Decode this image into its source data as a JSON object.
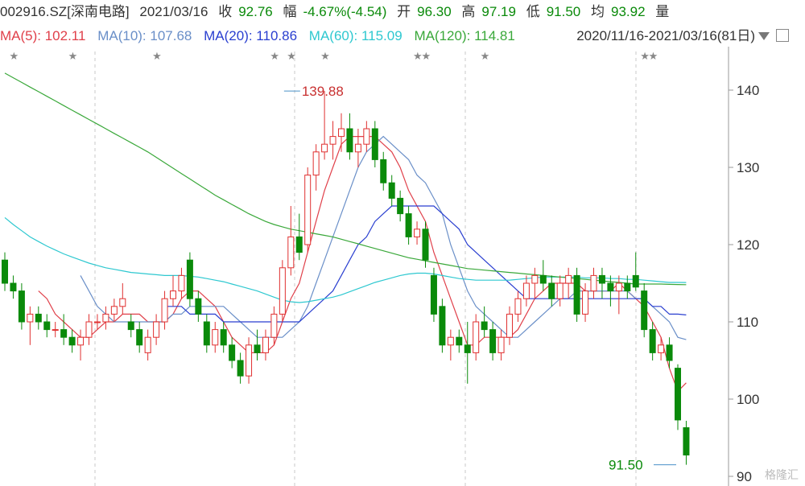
{
  "header": {
    "code": "002916.SZ[深南电路]",
    "date": "2021/03/16",
    "close_label": "收",
    "close": "92.76",
    "change_label": "幅",
    "change": "-4.67%(-4.54)",
    "open_label": "开",
    "open": "96.30",
    "high_label": "高",
    "high": "97.19",
    "low_label": "低",
    "low": "91.50",
    "avg_label": "均",
    "avg": "93.92",
    "vol_label": "量"
  },
  "ma_legend": [
    {
      "label": "MA(5): 102.11",
      "color": "#e0404a"
    },
    {
      "label": "MA(10): 107.68",
      "color": "#6a8fc8"
    },
    {
      "label": "MA(20): 110.86",
      "color": "#2a3fd0"
    },
    {
      "label": "MA(60): 115.09",
      "color": "#2ec8d0"
    },
    {
      "label": "MA(120): 114.81",
      "color": "#3aa83a"
    }
  ],
  "range_text": "2020/11/16-2021/03/16(81日)",
  "watermark": "格隆汇",
  "colors": {
    "up": "#e03030",
    "down": "#0a8a0a",
    "grid": "#c8c8c8"
  },
  "chart_data": {
    "type": "candlestick",
    "ylim": [
      90,
      145
    ],
    "yticks": [
      90,
      100,
      110,
      120,
      130,
      140
    ],
    "annotations": [
      {
        "text": "139.88",
        "index": 33,
        "value": 139.88
      },
      {
        "text": "91.50",
        "index": 80,
        "value": 91.5
      }
    ],
    "candles": [
      {
        "o": 118,
        "h": 119,
        "l": 114,
        "c": 115
      },
      {
        "o": 115,
        "h": 116,
        "l": 113,
        "c": 114
      },
      {
        "o": 114,
        "h": 115,
        "l": 109,
        "c": 110
      },
      {
        "o": 110,
        "h": 112,
        "l": 107,
        "c": 111
      },
      {
        "o": 111,
        "h": 112,
        "l": 109,
        "c": 110
      },
      {
        "o": 110,
        "h": 111,
        "l": 108,
        "c": 109
      },
      {
        "o": 109,
        "h": 110,
        "l": 108,
        "c": 109
      },
      {
        "o": 109,
        "h": 111,
        "l": 107,
        "c": 108
      },
      {
        "o": 108,
        "h": 109,
        "l": 106,
        "c": 107
      },
      {
        "o": 107,
        "h": 109,
        "l": 105,
        "c": 108
      },
      {
        "o": 108,
        "h": 111,
        "l": 107,
        "c": 110
      },
      {
        "o": 110,
        "h": 111,
        "l": 109,
        "c": 110
      },
      {
        "o": 110,
        "h": 112,
        "l": 109,
        "c": 111
      },
      {
        "o": 111,
        "h": 113,
        "l": 110,
        "c": 112
      },
      {
        "o": 112,
        "h": 115,
        "l": 111,
        "c": 113
      },
      {
        "o": 110,
        "h": 111,
        "l": 108,
        "c": 109
      },
      {
        "o": 109,
        "h": 110,
        "l": 106,
        "c": 107
      },
      {
        "o": 106,
        "h": 109,
        "l": 105,
        "c": 108
      },
      {
        "o": 108,
        "h": 111,
        "l": 107,
        "c": 110
      },
      {
        "o": 110,
        "h": 114,
        "l": 109,
        "c": 113
      },
      {
        "o": 113,
        "h": 116,
        "l": 112,
        "c": 114
      },
      {
        "o": 114,
        "h": 117,
        "l": 113,
        "c": 116
      },
      {
        "o": 118,
        "h": 119,
        "l": 112,
        "c": 113
      },
      {
        "o": 113,
        "h": 114,
        "l": 110,
        "c": 111
      },
      {
        "o": 110,
        "h": 111,
        "l": 106,
        "c": 107
      },
      {
        "o": 107,
        "h": 110,
        "l": 106,
        "c": 109
      },
      {
        "o": 109,
        "h": 110,
        "l": 106,
        "c": 107
      },
      {
        "o": 107,
        "h": 108,
        "l": 104,
        "c": 105
      },
      {
        "o": 105,
        "h": 106,
        "l": 102,
        "c": 103
      },
      {
        "o": 103,
        "h": 108,
        "l": 102,
        "c": 107
      },
      {
        "o": 107,
        "h": 109,
        "l": 105,
        "c": 106
      },
      {
        "o": 106,
        "h": 109,
        "l": 105,
        "c": 108
      },
      {
        "o": 108,
        "h": 112,
        "l": 107,
        "c": 111
      },
      {
        "o": 111,
        "h": 118,
        "l": 110,
        "c": 117
      },
      {
        "o": 117,
        "h": 125,
        "l": 116,
        "c": 121
      },
      {
        "o": 121,
        "h": 124,
        "l": 118,
        "c": 119
      },
      {
        "o": 120,
        "h": 130,
        "l": 119,
        "c": 129
      },
      {
        "o": 129,
        "h": 133,
        "l": 127,
        "c": 132
      },
      {
        "o": 132,
        "h": 139.88,
        "l": 131,
        "c": 133
      },
      {
        "o": 133,
        "h": 136,
        "l": 131,
        "c": 134
      },
      {
        "o": 134,
        "h": 137,
        "l": 132,
        "c": 135
      },
      {
        "o": 135,
        "h": 137,
        "l": 131,
        "c": 132
      },
      {
        "o": 132,
        "h": 135,
        "l": 130,
        "c": 133
      },
      {
        "o": 133,
        "h": 136,
        "l": 132,
        "c": 135
      },
      {
        "o": 135,
        "h": 136,
        "l": 130,
        "c": 131
      },
      {
        "o": 131,
        "h": 132,
        "l": 127,
        "c": 128
      },
      {
        "o": 128,
        "h": 129,
        "l": 125,
        "c": 126
      },
      {
        "o": 126,
        "h": 127,
        "l": 123,
        "c": 124
      },
      {
        "o": 124,
        "h": 125,
        "l": 120,
        "c": 121
      },
      {
        "o": 121,
        "h": 123,
        "l": 120,
        "c": 122
      },
      {
        "o": 122,
        "h": 123,
        "l": 117,
        "c": 118
      },
      {
        "o": 116,
        "h": 117,
        "l": 110,
        "c": 111
      },
      {
        "o": 112,
        "h": 113,
        "l": 106,
        "c": 107
      },
      {
        "o": 107,
        "h": 109,
        "l": 105,
        "c": 108
      },
      {
        "o": 108,
        "h": 109,
        "l": 106,
        "c": 107
      },
      {
        "o": 107,
        "h": 110,
        "l": 102,
        "c": 106
      },
      {
        "o": 106,
        "h": 111,
        "l": 105,
        "c": 110
      },
      {
        "o": 110,
        "h": 112,
        "l": 108,
        "c": 109
      },
      {
        "o": 109,
        "h": 110,
        "l": 105,
        "c": 106
      },
      {
        "o": 106,
        "h": 109,
        "l": 105,
        "c": 108
      },
      {
        "o": 108,
        "h": 112,
        "l": 107,
        "c": 111
      },
      {
        "o": 111,
        "h": 114,
        "l": 110,
        "c": 113
      },
      {
        "o": 113,
        "h": 116,
        "l": 112,
        "c": 115
      },
      {
        "o": 115,
        "h": 117,
        "l": 113,
        "c": 116
      },
      {
        "o": 116,
        "h": 118,
        "l": 114,
        "c": 115
      },
      {
        "o": 115,
        "h": 116,
        "l": 112,
        "c": 113
      },
      {
        "o": 113,
        "h": 116,
        "l": 112,
        "c": 115
      },
      {
        "o": 115,
        "h": 117,
        "l": 113,
        "c": 116
      },
      {
        "o": 116,
        "h": 117,
        "l": 110,
        "c": 111
      },
      {
        "o": 111,
        "h": 115,
        "l": 110,
        "c": 114
      },
      {
        "o": 114,
        "h": 117,
        "l": 113,
        "c": 116
      },
      {
        "o": 116,
        "h": 117,
        "l": 113,
        "c": 115
      },
      {
        "o": 115,
        "h": 116,
        "l": 112,
        "c": 114
      },
      {
        "o": 114,
        "h": 116,
        "l": 111,
        "c": 115
      },
      {
        "o": 115,
        "h": 116,
        "l": 113,
        "c": 114
      },
      {
        "o": 116,
        "h": 119,
        "l": 114,
        "c": 114.5
      },
      {
        "o": 114,
        "h": 115,
        "l": 108,
        "c": 109
      },
      {
        "o": 109,
        "h": 110,
        "l": 105,
        "c": 106
      },
      {
        "o": 106,
        "h": 108,
        "l": 105,
        "c": 107
      },
      {
        "o": 107,
        "h": 108,
        "l": 104,
        "c": 105
      },
      {
        "o": 104,
        "h": 104.5,
        "l": 96,
        "c": 97.3
      },
      {
        "o": 96.3,
        "h": 97.19,
        "l": 91.5,
        "c": 92.76
      }
    ],
    "series": [
      {
        "name": "MA(5)",
        "color": "#e0404a",
        "values": [
          null,
          null,
          null,
          null,
          114,
          113,
          111,
          110,
          109,
          108,
          108,
          109,
          110,
          110,
          111,
          111,
          111,
          110,
          110,
          110,
          111,
          113,
          114,
          114,
          113,
          112,
          110,
          108,
          107,
          106,
          106,
          106,
          107,
          110,
          113,
          115,
          119,
          123,
          127,
          130,
          133,
          134,
          134,
          134,
          134,
          133,
          132,
          130,
          127,
          125,
          123,
          119,
          116,
          113,
          110,
          107,
          107,
          108,
          108,
          108,
          108,
          109,
          111,
          113,
          114,
          115,
          115,
          115,
          115,
          114,
          114,
          114,
          114,
          115,
          114,
          113,
          112,
          110,
          108,
          104,
          101,
          102.1
        ]
      },
      {
        "name": "MA(10)",
        "color": "#6a8fc8",
        "values": [
          null,
          null,
          null,
          null,
          null,
          null,
          null,
          null,
          null,
          116,
          114,
          112,
          111,
          110,
          110,
          110,
          110,
          110,
          110,
          110,
          111,
          111,
          112,
          112,
          112,
          112,
          112,
          111,
          110,
          109,
          108,
          108,
          108,
          108,
          109,
          110,
          112,
          115,
          118,
          121,
          124,
          127,
          130,
          132,
          133,
          134,
          133,
          132,
          131,
          129,
          128,
          126,
          124,
          120,
          117,
          114,
          112,
          111,
          110,
          109,
          108,
          108,
          109,
          110,
          111,
          112,
          113,
          113,
          114,
          114,
          114,
          114,
          114,
          114,
          114,
          113,
          113,
          112,
          111,
          110,
          108,
          107.7
        ]
      },
      {
        "name": "MA(20)",
        "color": "#2a3fd0",
        "values": [
          null,
          null,
          null,
          null,
          null,
          null,
          null,
          null,
          null,
          null,
          null,
          null,
          null,
          null,
          null,
          null,
          null,
          null,
          null,
          112,
          112,
          112,
          111,
          111,
          111,
          111,
          110,
          110,
          110,
          110,
          110,
          110,
          110,
          110,
          110,
          110,
          111,
          112,
          113,
          114,
          116,
          118,
          120,
          121,
          123,
          124,
          125,
          125,
          125,
          125,
          125,
          125,
          124,
          123,
          122,
          120,
          119,
          118,
          117,
          116,
          115,
          114,
          113,
          113,
          113,
          113,
          113,
          113,
          113,
          113,
          113,
          113,
          113,
          113,
          113,
          113,
          113,
          112,
          112,
          111,
          111,
          110.9
        ]
      },
      {
        "name": "MA(60)",
        "color": "#2ec8d0",
        "values": [
          123.5,
          122.6,
          121.8,
          121.0,
          120.4,
          119.8,
          119.3,
          118.8,
          118.4,
          118.0,
          117.6,
          117.3,
          117.0,
          116.8,
          116.6,
          116.4,
          116.3,
          116.2,
          116.1,
          116.0,
          116.0,
          116.0,
          115.9,
          115.8,
          115.6,
          115.4,
          115.2,
          114.9,
          114.6,
          114.3,
          114.0,
          113.6,
          113.2,
          112.8,
          112.6,
          112.5,
          112.6,
          112.8,
          113.0,
          113.2,
          113.5,
          113.9,
          114.3,
          114.7,
          115.1,
          115.4,
          115.7,
          116.0,
          116.2,
          116.3,
          116.3,
          116.2,
          116.0,
          115.8,
          115.6,
          115.5,
          115.4,
          115.4,
          115.4,
          115.4,
          115.4,
          115.5,
          115.6,
          115.7,
          115.8,
          115.8,
          115.8,
          115.8,
          115.8,
          115.7,
          115.7,
          115.7,
          115.6,
          115.6,
          115.5,
          115.5,
          115.4,
          115.3,
          115.2,
          115.1,
          115.1,
          115.09
        ]
      },
      {
        "name": "MA(120)",
        "color": "#3aa83a",
        "values": [
          142.2,
          141.6,
          141.0,
          140.4,
          139.8,
          139.2,
          138.6,
          138.0,
          137.4,
          136.8,
          136.2,
          135.6,
          135.0,
          134.4,
          133.8,
          133.2,
          132.6,
          132.0,
          131.3,
          130.6,
          129.9,
          129.2,
          128.5,
          127.8,
          127.1,
          126.4,
          125.8,
          125.2,
          124.6,
          124.0,
          123.5,
          123.0,
          122.6,
          122.3,
          122.0,
          121.8,
          121.6,
          121.4,
          121.2,
          121.0,
          120.7,
          120.4,
          120.1,
          119.8,
          119.5,
          119.2,
          118.9,
          118.6,
          118.3,
          118.1,
          117.9,
          117.7,
          117.5,
          117.3,
          117.1,
          116.9,
          116.8,
          116.7,
          116.6,
          116.5,
          116.4,
          116.3,
          116.2,
          116.1,
          116.0,
          115.9,
          115.8,
          115.7,
          115.6,
          115.5,
          115.4,
          115.3,
          115.2,
          115.1,
          115.0,
          114.9,
          114.9,
          114.9,
          114.9,
          114.85,
          114.83,
          114.81
        ]
      }
    ],
    "markers": [
      1,
      8,
      18,
      32,
      34,
      38,
      49,
      50,
      57,
      76,
      77
    ]
  }
}
